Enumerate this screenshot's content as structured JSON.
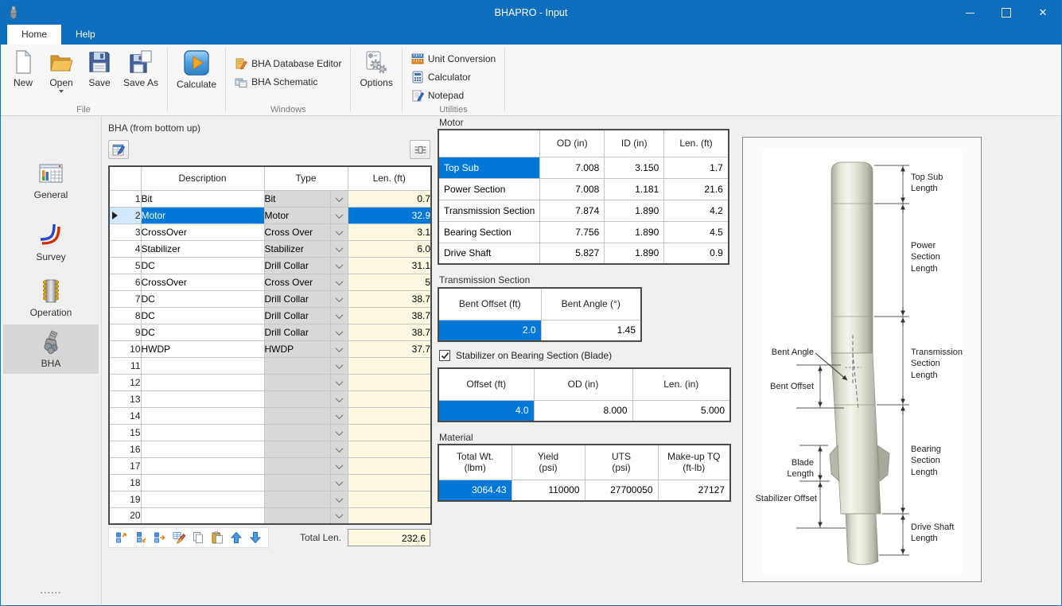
{
  "window": {
    "title": "BHAPRO - Input"
  },
  "tabs": [
    {
      "label": "Home",
      "active": true
    },
    {
      "label": "Help",
      "active": false
    }
  ],
  "ribbon": {
    "file_group": {
      "label": "File",
      "buttons": {
        "new": "New",
        "open": "Open",
        "save": "Save",
        "save_as": "Save As"
      }
    },
    "calculate_label": "Calculate",
    "windows_group": {
      "label": "Windows",
      "items": {
        "db_editor": "BHA Database Editor",
        "schematic": "BHA Schematic"
      }
    },
    "options_label": "Options",
    "utilities_group": {
      "label": "Utilities",
      "items": {
        "unit_conversion": "Unit Conversion",
        "calculator": "Calculator",
        "notepad": "Notepad"
      }
    }
  },
  "sidebar": {
    "items": [
      {
        "label": "General",
        "active": false
      },
      {
        "label": "Survey",
        "active": false
      },
      {
        "label": "Operation",
        "active": false
      },
      {
        "label": "BHA",
        "active": true
      }
    ],
    "dots": "......"
  },
  "bha_table": {
    "title": "BHA (from bottom up)",
    "headers": {
      "description": "Description",
      "type": "Type",
      "len": "Len. (ft)"
    },
    "rows": [
      {
        "num": 1,
        "description": "Bit",
        "type": "Bit",
        "len": "0.7",
        "selected": false
      },
      {
        "num": 2,
        "description": "Motor",
        "type": "Motor",
        "len": "32.9",
        "selected": true
      },
      {
        "num": 3,
        "description": "CrossOver",
        "type": "Cross Over",
        "len": "3.1",
        "selected": false
      },
      {
        "num": 4,
        "description": "Stabilizer",
        "type": "Stabilizer",
        "len": "6.0",
        "selected": false
      },
      {
        "num": 5,
        "description": "DC",
        "type": "Drill Collar",
        "len": "31.1",
        "selected": false
      },
      {
        "num": 6,
        "description": "CrossOver",
        "type": "Cross Over",
        "len": "5",
        "selected": false
      },
      {
        "num": 7,
        "description": "DC",
        "type": "Drill Collar",
        "len": "38.7",
        "selected": false
      },
      {
        "num": 8,
        "description": "DC",
        "type": "Drill Collar",
        "len": "38.7",
        "selected": false
      },
      {
        "num": 9,
        "description": "DC",
        "type": "Drill Collar",
        "len": "38.7",
        "selected": false
      },
      {
        "num": 10,
        "description": "HWDP",
        "type": "HWDP",
        "len": "37.7",
        "selected": false
      },
      {
        "num": 11,
        "description": "",
        "type": "",
        "len": "",
        "selected": false
      },
      {
        "num": 12,
        "description": "",
        "type": "",
        "len": "",
        "selected": false
      },
      {
        "num": 13,
        "description": "",
        "type": "",
        "len": "",
        "selected": false
      },
      {
        "num": 14,
        "description": "",
        "type": "",
        "len": "",
        "selected": false
      },
      {
        "num": 15,
        "description": "",
        "type": "",
        "len": "",
        "selected": false
      },
      {
        "num": 16,
        "description": "",
        "type": "",
        "len": "",
        "selected": false
      },
      {
        "num": 17,
        "description": "",
        "type": "",
        "len": "",
        "selected": false
      },
      {
        "num": 18,
        "description": "",
        "type": "",
        "len": "",
        "selected": false
      },
      {
        "num": 19,
        "description": "",
        "type": "",
        "len": "",
        "selected": false
      },
      {
        "num": 20,
        "description": "",
        "type": "",
        "len": "",
        "selected": false
      }
    ],
    "total_label": "Total Len.",
    "total_value": "232.6"
  },
  "motor_table": {
    "title": "Motor",
    "headers": {
      "od": "OD (in)",
      "id": "ID (in)",
      "len": "Len. (ft)"
    },
    "rows": [
      {
        "name": "Top Sub",
        "od": "7.008",
        "id": "3.150",
        "len": "1.7",
        "selected": true
      },
      {
        "name": "Power Section",
        "od": "7.008",
        "id": "1.181",
        "len": "21.6",
        "selected": false
      },
      {
        "name": "Transmission Section",
        "od": "7.874",
        "id": "1.890",
        "len": "4.2",
        "selected": false
      },
      {
        "name": "Bearing Section",
        "od": "7.756",
        "id": "1.890",
        "len": "4.5",
        "selected": false
      },
      {
        "name": "Drive Shaft",
        "od": "5.827",
        "id": "1.890",
        "len": "0.9",
        "selected": false
      }
    ]
  },
  "transmission": {
    "title": "Transmission Section",
    "headers": {
      "bent_offset": "Bent Offset (ft)",
      "bent_angle": "Bent Angle (°)"
    },
    "values": {
      "bent_offset": "2.0",
      "bent_angle": "1.45"
    }
  },
  "stabilizer": {
    "checkbox_label": "Stabilizer on Bearing Section (Blade)",
    "checked": true,
    "headers": {
      "offset": "Offset (ft)",
      "od": "OD (in)",
      "len": "Len. (in)"
    },
    "values": {
      "offset": "4.0",
      "od": "8.000",
      "len": "5.000"
    }
  },
  "material": {
    "title": "Material",
    "headers": {
      "total_wt": "Total Wt.\n(lbm)",
      "yield": "Yield\n(psi)",
      "uts": "UTS\n(psi)",
      "makeup_tq": "Make-up TQ\n(ft-lb)"
    },
    "values": {
      "total_wt": "3064.43",
      "yield": "110000",
      "uts": "27700050",
      "makeup_tq": "27127"
    }
  },
  "schematic": {
    "labels_right": [
      "Top Sub\nLength",
      "Power\nSection\nLength",
      "Transmission\nSection\nLength",
      "Bearing\nSection\nLength",
      "Drive Shaft\nLength"
    ],
    "labels_left": [
      "Bent Angle",
      "Bent Offset",
      "Blade Length",
      "Stabilizer Offset"
    ]
  },
  "colors": {
    "titlebar": "#0d6ebe",
    "selection": "#0078d7",
    "editable_cell": "#fdf8e1",
    "type_cell": "#d8d8d8"
  }
}
